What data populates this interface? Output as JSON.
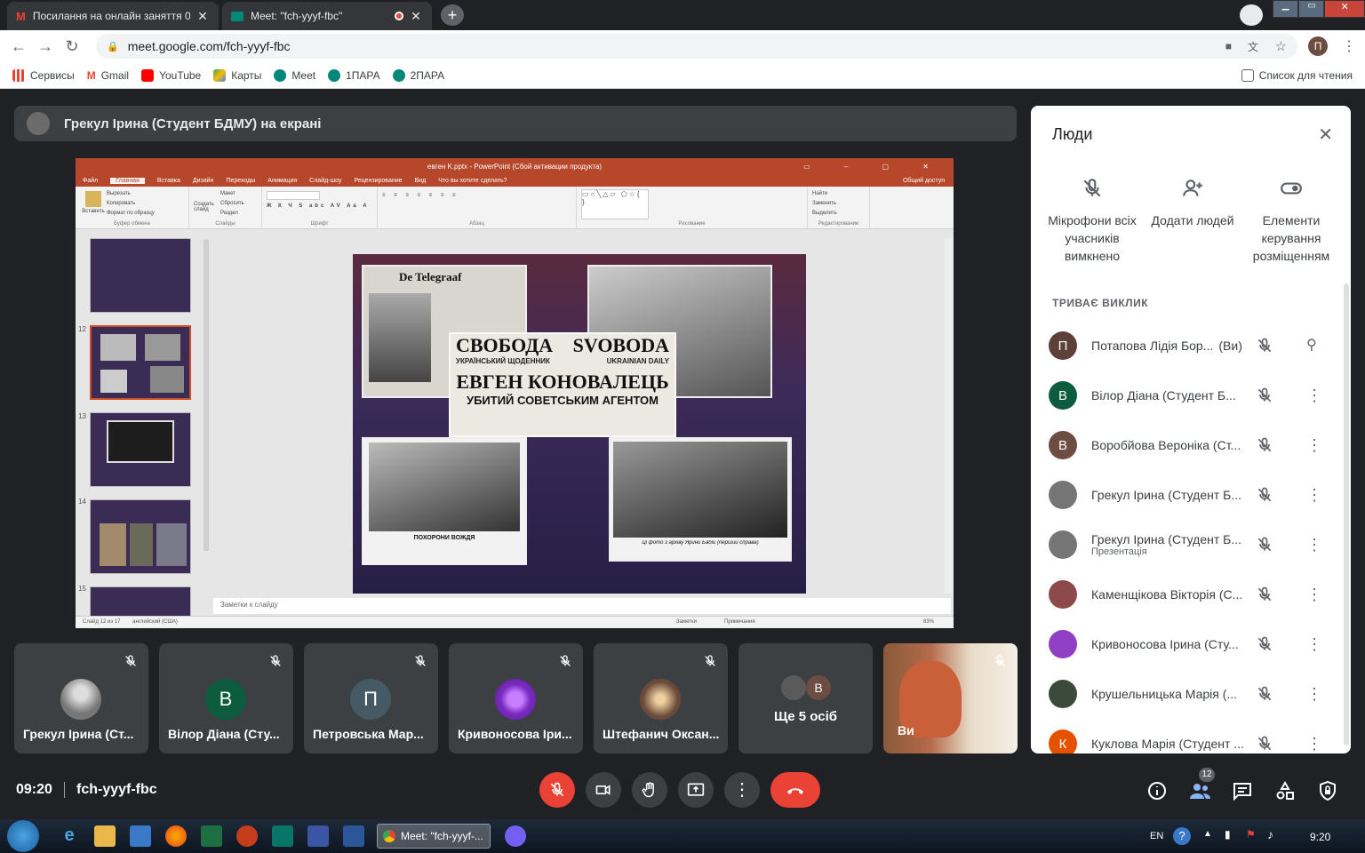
{
  "browser": {
    "tabs": [
      {
        "title": "Посилання на онлайн заняття 0",
        "active": false
      },
      {
        "title": "Meet: \"fch-yyyf-fbc\"",
        "active": true
      }
    ],
    "url": "meet.google.com/fch-yyyf-fbc",
    "bookmarks": [
      "Сервисы",
      "Gmail",
      "YouTube",
      "Карты",
      "Meet",
      "1ПАРА",
      "2ПАРА"
    ],
    "reading_list": "Список для чтения",
    "profile_initial": "П"
  },
  "presentation": {
    "banner": "Грекул Ірина (Студент БДМУ) на екрані",
    "ppt": {
      "title": "евген K.pptx - PowerPoint (Сбой активации продукта)",
      "menu": [
        "Файл",
        "Главная",
        "Вставка",
        "Дизайн",
        "Переходы",
        "Анимация",
        "Слайд-шоу",
        "Рецензирование",
        "Вид",
        "Что вы хотите сделать?"
      ],
      "share": "Общий доступ",
      "ribbon_groups": [
        "Буфер обмена",
        "Слайды",
        "Шрифт",
        "Абзац",
        "Рисование",
        "Редактирование"
      ],
      "clipboard": [
        "Вставить",
        "Вырезать",
        "Копировать",
        "Формат по образцу"
      ],
      "slides_group": [
        "Создать слайд",
        "Макет",
        "Сбросить",
        "Раздел"
      ],
      "editing": [
        "Найти",
        "Заменить",
        "Выделить"
      ],
      "thumb_numbers": [
        "12",
        "13",
        "14",
        "15"
      ],
      "notes": "Заметки к слайду",
      "status": "Слайд 12 из 17",
      "status_lang": "английский (США)",
      "status_right": [
        "Заметки",
        "Примечания"
      ],
      "zoom": "83%",
      "slide_text": {
        "masthead": "De Telegraaf",
        "headline1": "СВОБОДА",
        "headline2": "SVOBODA",
        "sub1": "УКРАЇНСЬКИЙ ЩОДЕННИК",
        "sub2": "UKRAINIAN DAILY",
        "big": "ЕВГЕН КОНОВАЛЕЦЬ",
        "big2": "УБИТИЙ СОВЕТСЬКИМ АГЕНТОМ",
        "caption1": "ПОХОРОНИ ВОЖДЯ",
        "caption2": "Ці фото з архіву Ярини Бабій (перший справа)"
      }
    }
  },
  "tiles": [
    {
      "name": "Грекул Ірина (Ст...",
      "initial": "",
      "color": "#7a7a7a"
    },
    {
      "name": "Вілор Діана (Сту...",
      "initial": "В",
      "color": "#0d5c3f"
    },
    {
      "name": "Петровська Мар...",
      "initial": "П",
      "color": "#455a64"
    },
    {
      "name": "Кривоносова Іри...",
      "initial": "",
      "color": "#8e3fc4"
    },
    {
      "name": "Штефанич Оксан...",
      "initial": "",
      "color": "#6b4a3a"
    }
  ],
  "more_tile": {
    "label": "Ще 5 осіб",
    "initial": "В"
  },
  "self_tile": {
    "label": "Ви"
  },
  "people_panel": {
    "title": "Люди",
    "actions": [
      "Мікрофони всіх учасників вимкнено",
      "Додати людей",
      "Елементи керування розміщенням"
    ],
    "section": "ТРИВАЄ ВИКЛИК",
    "list": [
      {
        "name": "Потапова Лідія Бор...",
        "suffix": "(Ви)",
        "sub": "",
        "initial": "П",
        "color": "#5d4037"
      },
      {
        "name": "Вілор Діана (Студент Б...",
        "suffix": "",
        "sub": "",
        "initial": "В",
        "color": "#0d5c3f"
      },
      {
        "name": "Воробйова Вероніка (Ст...",
        "suffix": "",
        "sub": "",
        "initial": "В",
        "color": "#6d4c41"
      },
      {
        "name": "Грекул Ірина (Студент Б...",
        "suffix": "",
        "sub": "",
        "initial": "",
        "color": "#757575"
      },
      {
        "name": "Грекул Ірина (Студент Б...",
        "suffix": "",
        "sub": "Презентація",
        "initial": "",
        "color": "#757575"
      },
      {
        "name": "Каменщікова Вікторія (С...",
        "suffix": "",
        "sub": "",
        "initial": "",
        "color": "#8d4a4a"
      },
      {
        "name": "Кривоносова Ірина (Сту...",
        "suffix": "",
        "sub": "",
        "initial": "",
        "color": "#8e3fc4"
      },
      {
        "name": "Крушельницька Марія (...",
        "suffix": "",
        "sub": "",
        "initial": "",
        "color": "#3b4a3b"
      },
      {
        "name": "Куклова Марія (Студент ...",
        "suffix": "",
        "sub": "",
        "initial": "К",
        "color": "#e65100"
      }
    ]
  },
  "bottom_bar": {
    "time": "09:20",
    "code": "fch-yyyf-fbc",
    "participants_count": "12"
  },
  "taskbar": {
    "active_window": "Meet: \"fch-yyyf-...",
    "lang": "EN",
    "clock": "9:20"
  }
}
